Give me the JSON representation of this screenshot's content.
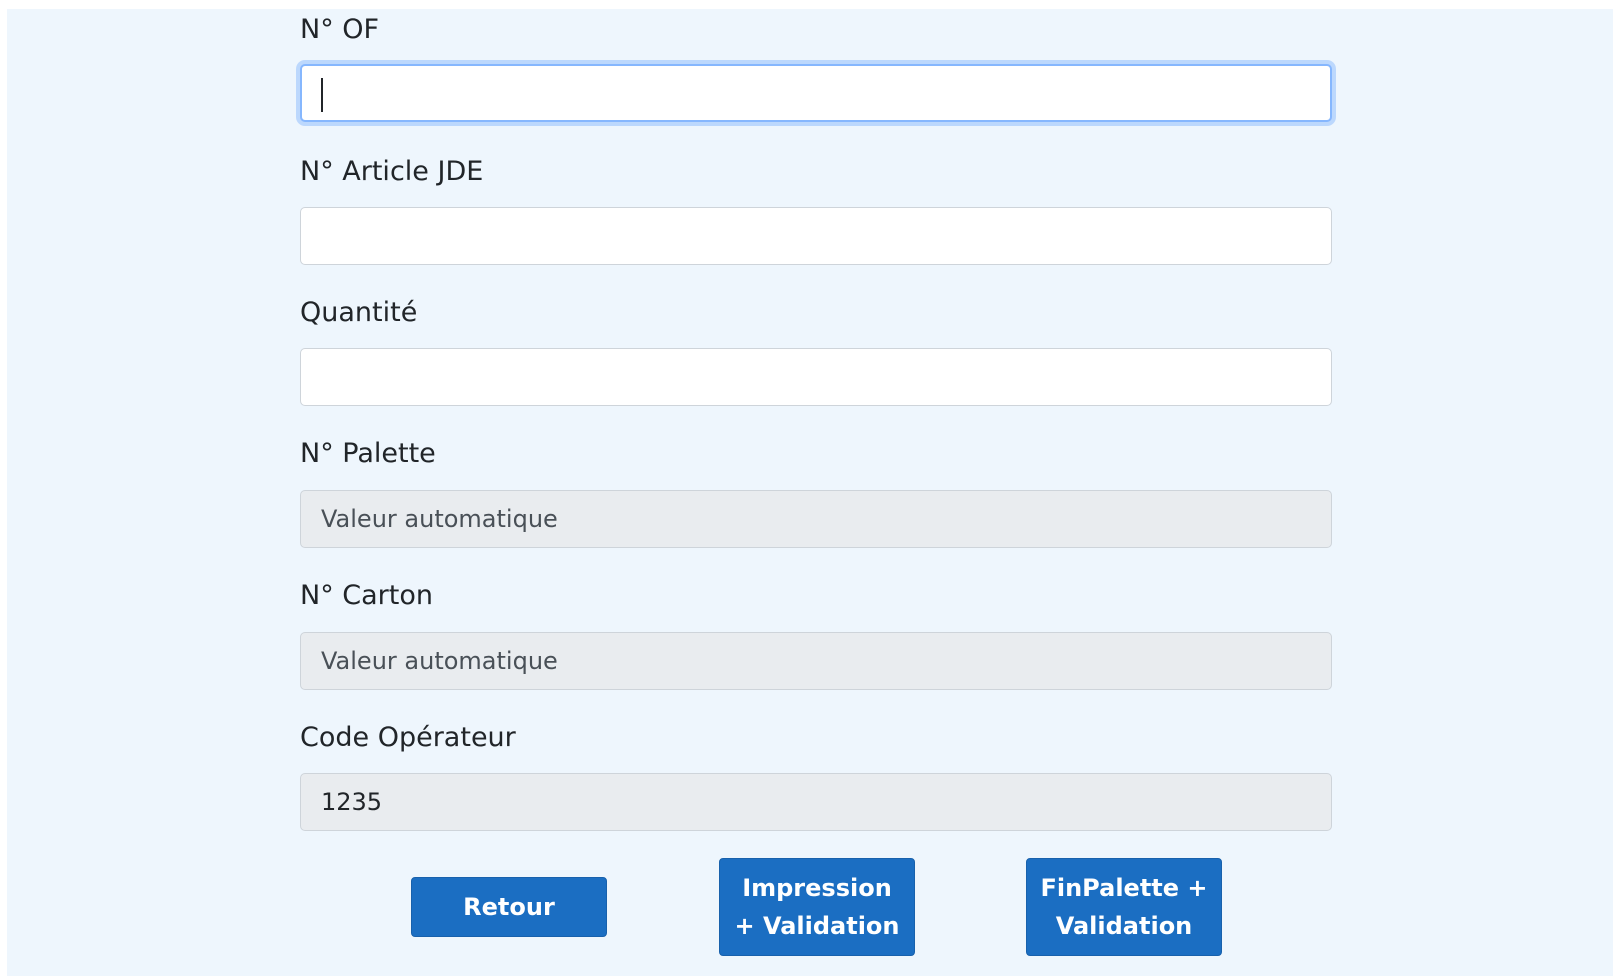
{
  "form": {
    "fields": [
      {
        "label": "N° OF",
        "value": "",
        "placeholder": "",
        "readonly": false,
        "focused": true
      },
      {
        "label": "N° Article JDE",
        "value": "",
        "placeholder": "",
        "readonly": false,
        "focused": false
      },
      {
        "label": "Quantité",
        "value": "",
        "placeholder": "",
        "readonly": false,
        "focused": false
      },
      {
        "label": "N° Palette",
        "value": "",
        "placeholder": "Valeur automatique",
        "readonly": true,
        "focused": false
      },
      {
        "label": "N° Carton",
        "value": "",
        "placeholder": "Valeur automatique",
        "readonly": true,
        "focused": false
      },
      {
        "label": "Code Opérateur",
        "value": "1235",
        "placeholder": "",
        "readonly": true,
        "focused": false
      }
    ]
  },
  "actions": {
    "back_label": "Retour",
    "print_validate_label": "Impression\n+ Validation",
    "end_pallet_validate_label": "FinPalette +\nValidation"
  },
  "colors": {
    "page_background": "#eef6fd",
    "primary_button": "#1b6ec2",
    "readonly_input": "#e9ecef",
    "focus_ring": "#86b7fe"
  }
}
